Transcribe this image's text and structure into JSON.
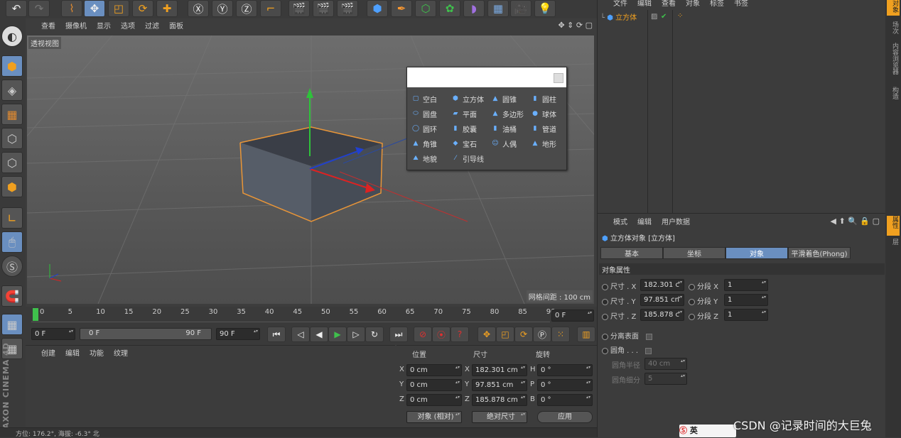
{
  "viewport": {
    "menus": [
      "查看",
      "摄像机",
      "显示",
      "选项",
      "过滤",
      "面板"
    ],
    "label": "透视视图",
    "grid": "网格间距 : 100 cm"
  },
  "popup": {
    "items": [
      [
        "空白",
        "立方体",
        "圆锥",
        "圆柱"
      ],
      [
        "圆盘",
        "平面",
        "多边形",
        "球体"
      ],
      [
        "圆环",
        "胶囊",
        "油桶",
        "管道"
      ],
      [
        "角锥",
        "宝石",
        "人偶",
        "地形"
      ],
      [
        "地貌",
        "引导线"
      ]
    ]
  },
  "timeline": {
    "ticks": [
      "0",
      "5",
      "10",
      "15",
      "20",
      "25",
      "30",
      "35",
      "40",
      "45",
      "50",
      "55",
      "60",
      "65",
      "70",
      "75",
      "80",
      "85",
      "90"
    ],
    "frame_end": "0 F",
    "start": "0 F",
    "range_start": "0 F",
    "range_end": "90 F",
    "end": "90 F"
  },
  "material": {
    "menus": [
      "创建",
      "编辑",
      "功能",
      "纹理"
    ]
  },
  "coords": {
    "headers": [
      "位置",
      "尺寸",
      "旋转"
    ],
    "rows": [
      {
        "a": "X",
        "pos": "0 cm",
        "b": "X",
        "size": "182.301 cm",
        "c": "H",
        "rot": "0 °"
      },
      {
        "a": "Y",
        "pos": "0 cm",
        "b": "Y",
        "size": "97.851 cm",
        "c": "P",
        "rot": "0 °"
      },
      {
        "a": "Z",
        "pos": "0 cm",
        "b": "Z",
        "size": "185.878 cm",
        "c": "B",
        "rot": "0 °"
      }
    ],
    "mode1": "对象 (相对)",
    "mode2": "绝对尺寸",
    "apply": "应用"
  },
  "status": "方位: 176.2°, 海拔: -6.3° 北",
  "objects": {
    "menus": [
      "文件",
      "编辑",
      "查看",
      "对象",
      "标签",
      "书签"
    ],
    "item": "立方体"
  },
  "attrs": {
    "menus": [
      "模式",
      "编辑",
      "用户数据"
    ],
    "title": "立方体对象 [立方体]",
    "tabs": [
      "基本",
      "坐标",
      "对象",
      "平滑着色(Phong)"
    ],
    "section": "对象属性",
    "rows": [
      {
        "l": "尺寸 . X",
        "v": "182.301 c",
        "sl": "分段 X",
        "sv": "1"
      },
      {
        "l": "尺寸 . Y",
        "v": "97.851 cn",
        "sl": "分段 Y",
        "sv": "1"
      },
      {
        "l": "尺寸 . Z",
        "v": "185.878 c",
        "sl": "分段 Z",
        "sv": "1"
      }
    ],
    "sep": "分离表面",
    "fillet": "圆角 . . .",
    "radius_l": "圆角半径",
    "radius_v": "40 cm",
    "sub_l": "圆角细分",
    "sub_v": "5"
  },
  "right_tabs": [
    "对象",
    "场次",
    "内容浏览器",
    "构造"
  ],
  "attr_tabs": [
    "属性",
    "层"
  ],
  "brand": "MAXON CINEMA 4D",
  "watermark": "CSDN @记录时间的大巨兔",
  "ime": "英"
}
